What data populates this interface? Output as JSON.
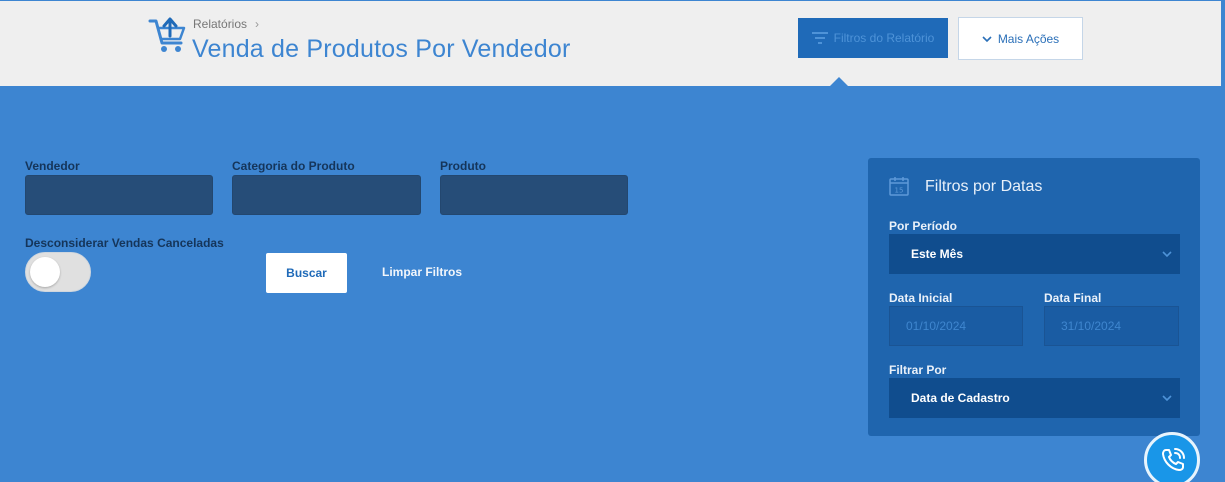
{
  "header": {
    "breadcrumb": "Relatórios",
    "title": "Venda de Produtos Por Vendedor",
    "filters_button": "Filtros do Relatório",
    "more_button": "Mais Ações"
  },
  "filters": {
    "seller_label": "Vendedor",
    "category_label": "Categoria do Produto",
    "product_label": "Produto",
    "ignore_canceled_label": "Desconsiderar Vendas Canceladas",
    "ignore_canceled_on": false,
    "search_button": "Buscar",
    "clear_link": "Limpar Filtros"
  },
  "date_panel": {
    "title": "Filtros por Datas",
    "period_label": "Por Período",
    "period_value": "Este Mês",
    "start_label": "Data Inicial",
    "start_value": "01/10/2024",
    "end_label": "Data Final",
    "end_value": "31/10/2024",
    "filter_by_label": "Filtrar Por",
    "filter_by_value": "Data de Cadastro"
  },
  "colors": {
    "primary": "#3d85d1",
    "dark_field": "#264d78",
    "panel": "#1f65ae",
    "phone_button": "#1996e8"
  },
  "icons": {
    "cart": "cart-upload-icon",
    "filter": "filter-lines-icon",
    "chevron": "chevron-down-icon",
    "calendar": "calendar-icon",
    "phone": "phone-ringing-icon"
  }
}
